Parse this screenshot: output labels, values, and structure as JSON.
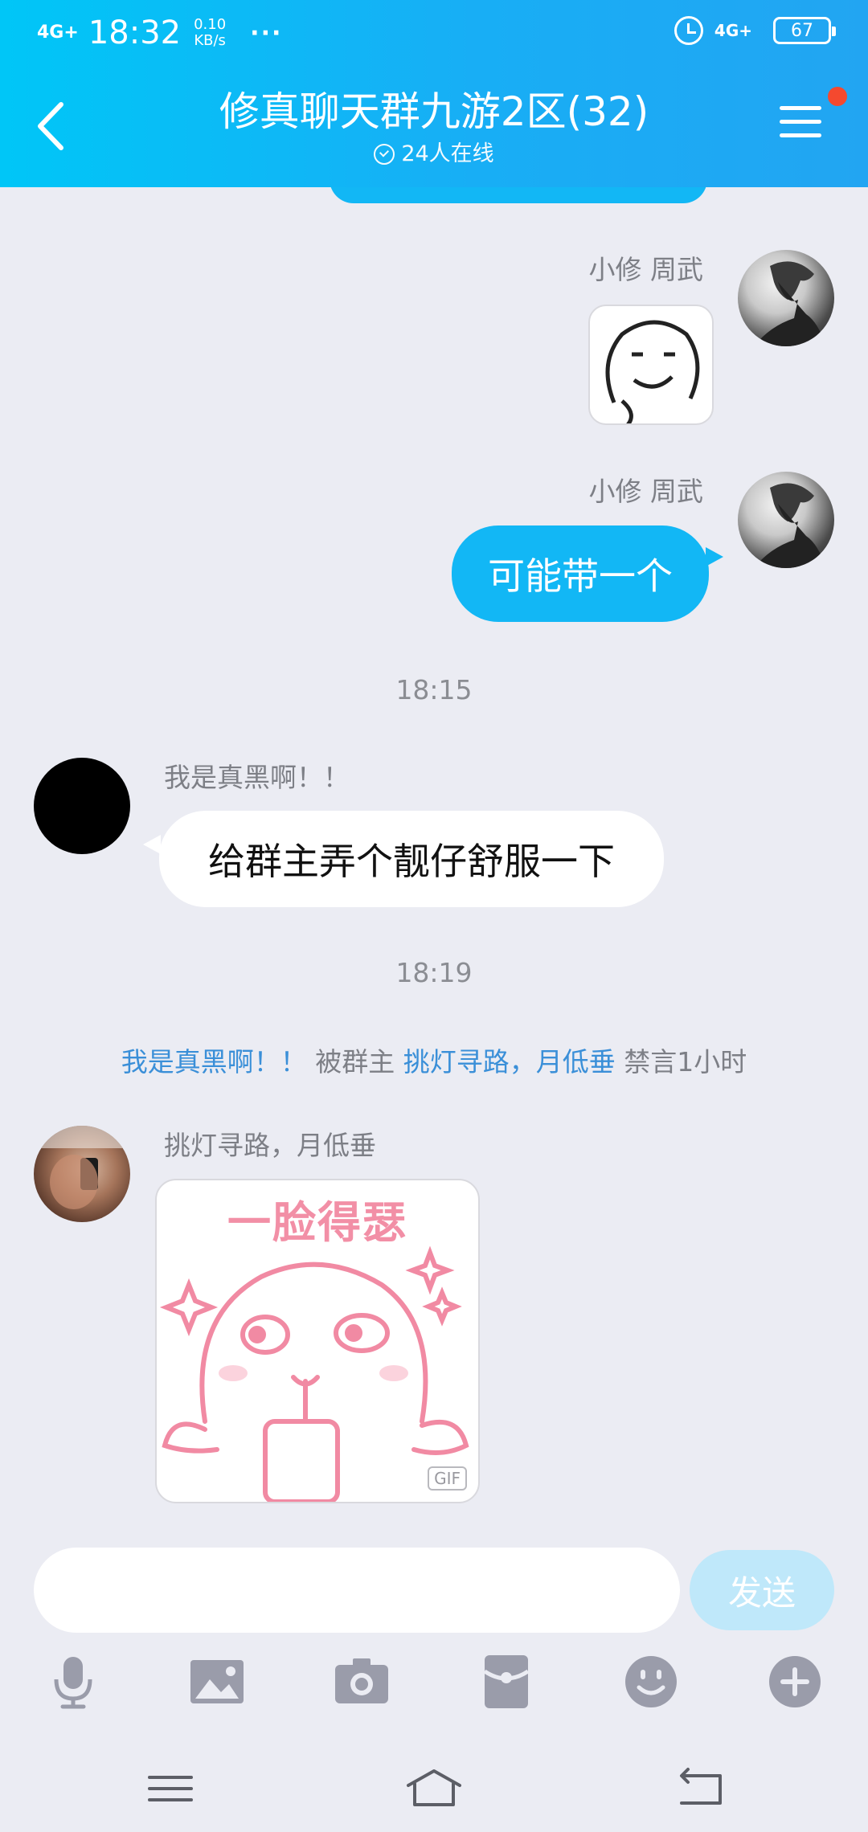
{
  "status_bar": {
    "signal": "4G+",
    "time": "18:32",
    "speed_value": "0.10",
    "speed_unit": "KB/s",
    "more": "···",
    "network": "4G+",
    "battery": "67"
  },
  "header": {
    "title": "修真聊天群九游2区(32)",
    "online_text": "24人在线"
  },
  "messages": [
    {
      "sender": "小修 周武",
      "type": "sticker"
    },
    {
      "sender": "小修 周武",
      "text": "可能带一个"
    },
    {
      "timestamp": "18:15"
    },
    {
      "sender": "我是真黑啊！！",
      "text": "给群主弄个靓仔舒服一下"
    },
    {
      "timestamp": "18:19"
    },
    {
      "system": {
        "user": "我是真黑啊！！",
        "action_prefix": "被群主",
        "admin": "挑灯寻路，月低垂",
        "action_suffix": "禁言1小时"
      }
    },
    {
      "sender": "挑灯寻路，月低垂",
      "type": "gif",
      "sticker_text": "一脸得瑟",
      "badge": "GIF"
    }
  ],
  "composer": {
    "placeholder": "",
    "send_label": "发送"
  },
  "toolbar": [
    "microphone-icon",
    "image-icon",
    "camera-icon",
    "red-packet-icon",
    "emoji-icon",
    "plus-icon"
  ],
  "colors": {
    "header_gradient_start": "#00c6f7",
    "header_gradient_end": "#22a5f2",
    "bubble_blue": "#12b7f5",
    "background": "#ebecf3",
    "link": "#3a8fd8",
    "send_disabled": "#bfe8fa",
    "notification_dot": "#f4492f"
  }
}
